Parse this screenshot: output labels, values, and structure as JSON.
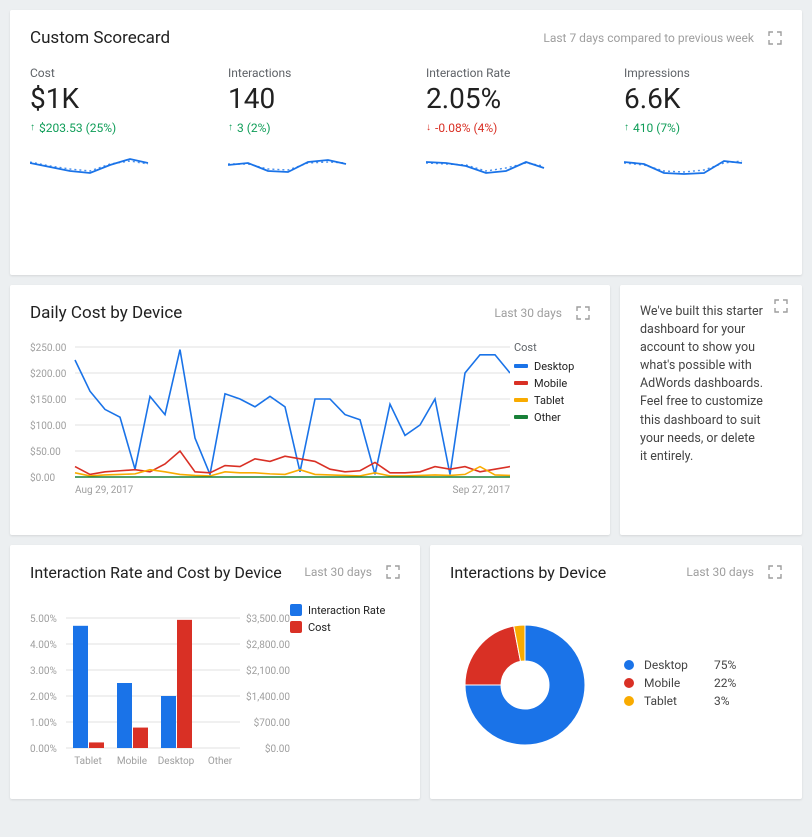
{
  "scorecard": {
    "title": "Custom Scorecard",
    "subtitle": "Last 7 days compared to previous week",
    "metrics": [
      {
        "label": "Cost",
        "value": "$1K",
        "delta": "$203.53 (25%)",
        "direction": "up"
      },
      {
        "label": "Interactions",
        "value": "140",
        "delta": "3 (2%)",
        "direction": "up"
      },
      {
        "label": "Interaction Rate",
        "value": "2.05%",
        "delta": "-0.08% (4%)",
        "direction": "down"
      },
      {
        "label": "Impressions",
        "value": "6.6K",
        "delta": "410 (7%)",
        "direction": "up"
      }
    ]
  },
  "daily_cost": {
    "title": "Daily Cost by Device",
    "subtitle": "Last 30 days",
    "start_date": "Aug 29, 2017",
    "end_date": "Sep 27, 2017",
    "legend_title": "Cost",
    "legend": [
      {
        "name": "Desktop",
        "color": "#1a73e8"
      },
      {
        "name": "Mobile",
        "color": "#d93025"
      },
      {
        "name": "Tablet",
        "color": "#f9ab00"
      },
      {
        "name": "Other",
        "color": "#188038"
      }
    ],
    "y_ticks": [
      "$250.00",
      "$200.00",
      "$150.00",
      "$100.00",
      "$50.00",
      "$0.00"
    ]
  },
  "info_text": "We've built this starter dashboard for your account to show you what's possible with AdWords dashboards. Feel free to customize this dashboard to suit your needs, or delete it entirely.",
  "bar_chart": {
    "title": "Interaction Rate and Cost by Device",
    "subtitle": "Last 30 days",
    "left_ticks": [
      "5.00%",
      "4.00%",
      "3.00%",
      "2.00%",
      "1.00%",
      "0.00%"
    ],
    "right_ticks": [
      "$3,500.00",
      "$2,800.00",
      "$2,100.00",
      "$1,400.00",
      "$700.00",
      "$0.00"
    ],
    "categories": [
      "Tablet",
      "Mobile",
      "Desktop",
      "Other"
    ],
    "legend": [
      {
        "name": "Interaction Rate",
        "color": "#1a73e8"
      },
      {
        "name": "Cost",
        "color": "#d93025"
      }
    ]
  },
  "donut": {
    "title": "Interactions by Device",
    "subtitle": "Last 30 days",
    "items": [
      {
        "name": "Desktop",
        "value": "75%",
        "color": "#1a73e8"
      },
      {
        "name": "Mobile",
        "value": "22%",
        "color": "#d93025"
      },
      {
        "name": "Tablet",
        "value": "3%",
        "color": "#f9ab00"
      }
    ]
  },
  "chart_data": [
    {
      "id": "scorecard_sparklines",
      "type": "line",
      "note": "Each metric has a 7-point current-week sparkline and a 7-point previous-week dotted comparison. Values are relative (normalized 0–1) as no axis is shown.",
      "series": [
        {
          "name": "Cost current",
          "values": [
            0.5,
            0.42,
            0.35,
            0.3,
            0.48,
            0.62,
            0.55
          ]
        },
        {
          "name": "Cost previous",
          "values": [
            0.52,
            0.45,
            0.38,
            0.34,
            0.5,
            0.58,
            0.52
          ]
        },
        {
          "name": "Interactions current",
          "values": [
            0.48,
            0.52,
            0.35,
            0.32,
            0.55,
            0.6,
            0.5
          ]
        },
        {
          "name": "Interactions previous",
          "values": [
            0.5,
            0.5,
            0.38,
            0.36,
            0.52,
            0.56,
            0.52
          ]
        },
        {
          "name": "Interaction Rate current",
          "values": [
            0.55,
            0.52,
            0.45,
            0.3,
            0.35,
            0.55,
            0.4
          ]
        },
        {
          "name": "Interaction Rate previous",
          "values": [
            0.52,
            0.5,
            0.48,
            0.34,
            0.4,
            0.52,
            0.45
          ]
        },
        {
          "name": "Impressions current",
          "values": [
            0.55,
            0.5,
            0.3,
            0.28,
            0.3,
            0.58,
            0.52
          ]
        },
        {
          "name": "Impressions previous",
          "values": [
            0.52,
            0.48,
            0.34,
            0.32,
            0.36,
            0.54,
            0.56
          ]
        }
      ]
    },
    {
      "id": "daily_cost_by_device",
      "type": "line",
      "title": "Daily Cost by Device",
      "xlabel": "",
      "ylabel": "Cost ($)",
      "ylim": [
        0,
        250
      ],
      "x_range": [
        "Aug 29, 2017",
        "Sep 27, 2017"
      ],
      "x": [
        0,
        1,
        2,
        3,
        4,
        5,
        6,
        7,
        8,
        9,
        10,
        11,
        12,
        13,
        14,
        15,
        16,
        17,
        18,
        19,
        20,
        21,
        22,
        23,
        24,
        25,
        26,
        27,
        28,
        29
      ],
      "series": [
        {
          "name": "Desktop",
          "color": "#1a73e8",
          "values": [
            225,
            165,
            130,
            115,
            15,
            155,
            120,
            245,
            75,
            5,
            160,
            150,
            135,
            155,
            135,
            10,
            150,
            150,
            120,
            110,
            5,
            140,
            80,
            100,
            150,
            5,
            200,
            235,
            235,
            200
          ]
        },
        {
          "name": "Mobile",
          "color": "#d93025",
          "values": [
            20,
            5,
            10,
            12,
            14,
            10,
            25,
            50,
            10,
            8,
            22,
            20,
            35,
            30,
            40,
            35,
            30,
            15,
            10,
            12,
            28,
            8,
            8,
            10,
            20,
            15,
            20,
            10,
            15,
            20
          ]
        },
        {
          "name": "Tablet",
          "color": "#f9ab00",
          "values": [
            8,
            2,
            4,
            5,
            6,
            14,
            10,
            5,
            3,
            2,
            10,
            8,
            8,
            6,
            5,
            14,
            5,
            4,
            3,
            2,
            8,
            2,
            2,
            3,
            4,
            3,
            5,
            20,
            4,
            3
          ]
        },
        {
          "name": "Other",
          "color": "#188038",
          "values": [
            0,
            0,
            0,
            0,
            0,
            0,
            0,
            0,
            0,
            0,
            0,
            0,
            0,
            0,
            0,
            0,
            0,
            0,
            0,
            0,
            0,
            0,
            0,
            0,
            0,
            0,
            0,
            0,
            0,
            0
          ]
        }
      ]
    },
    {
      "id": "interaction_rate_and_cost_by_device",
      "type": "bar",
      "title": "Interaction Rate and Cost by Device",
      "categories": [
        "Tablet",
        "Mobile",
        "Desktop",
        "Other"
      ],
      "series": [
        {
          "name": "Interaction Rate",
          "axis": "left",
          "unit": "%",
          "color": "#1a73e8",
          "values": [
            4.7,
            2.5,
            2.0,
            0.0
          ]
        },
        {
          "name": "Cost",
          "axis": "right",
          "unit": "$",
          "color": "#d93025",
          "values": [
            150,
            550,
            3450,
            0
          ]
        }
      ],
      "left_axis": {
        "ylim": [
          0,
          5
        ],
        "ticks": [
          0,
          1,
          2,
          3,
          4,
          5
        ],
        "format": "percent"
      },
      "right_axis": {
        "ylim": [
          0,
          3500
        ],
        "ticks": [
          0,
          700,
          1400,
          2100,
          2800,
          3500
        ],
        "format": "usd"
      }
    },
    {
      "id": "interactions_by_device",
      "type": "pie",
      "title": "Interactions by Device",
      "slices": [
        {
          "name": "Desktop",
          "value": 75,
          "color": "#1a73e8"
        },
        {
          "name": "Mobile",
          "value": 22,
          "color": "#d93025"
        },
        {
          "name": "Tablet",
          "value": 3,
          "color": "#f9ab00"
        }
      ]
    }
  ]
}
